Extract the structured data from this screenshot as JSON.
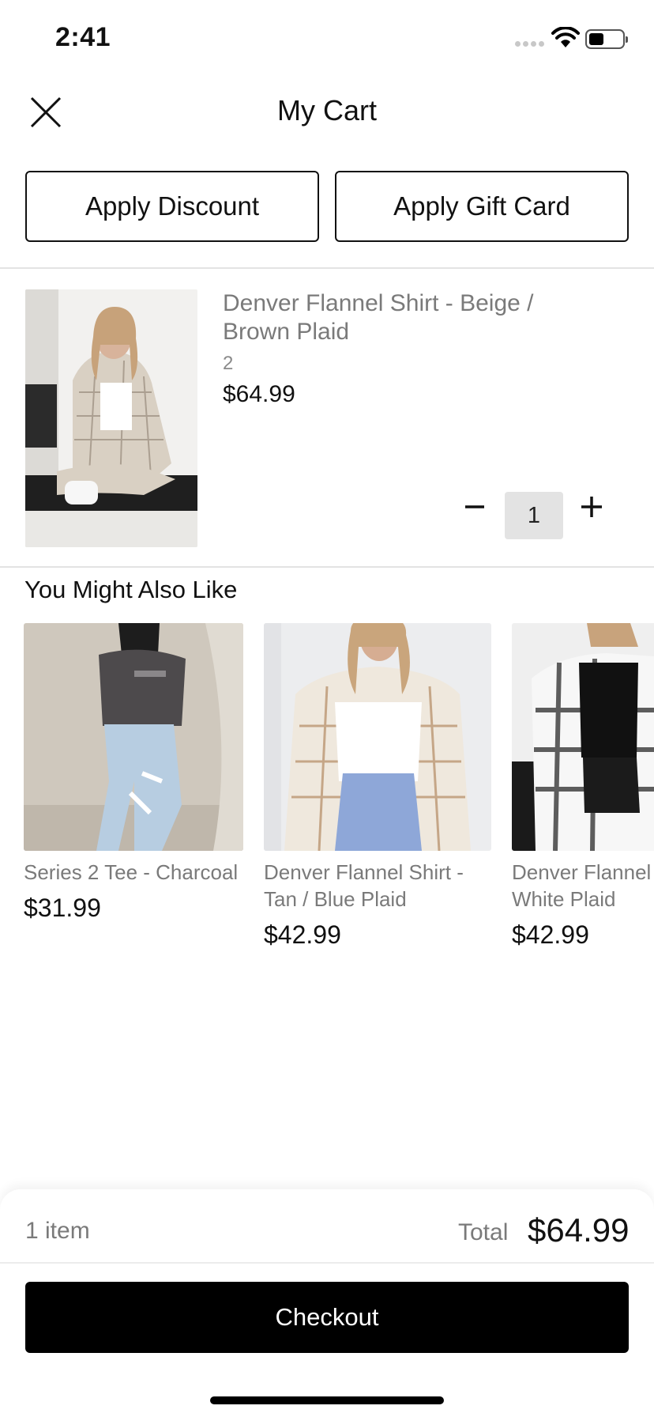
{
  "status_bar": {
    "time": "2:41",
    "battery_level": 0.45
  },
  "header": {
    "title": "My Cart",
    "close_icon": "close-x-icon"
  },
  "actions": {
    "apply_discount": "Apply Discount",
    "apply_gift_card": "Apply Gift Card"
  },
  "cart": {
    "items": [
      {
        "name": "Denver Flannel Shirt - Beige / Brown Plaid",
        "variant": "2",
        "price": "$64.99",
        "quantity": "1",
        "image": "beige-brown-plaid-flannel-photo"
      }
    ]
  },
  "recommendations": {
    "title": "You Might Also Like",
    "items": [
      {
        "name_line1": "Series 2 Tee - Charcoal",
        "name_line2": "",
        "price": "$31.99",
        "image": "charcoal-tee-photo"
      },
      {
        "name_line1": "Denver Flannel Shirt -",
        "name_line2": "Tan / Blue Plaid",
        "price": "$42.99",
        "image": "tan-blue-plaid-flannel-photo"
      },
      {
        "name_line1": "Denver Flannel",
        "name_line2": "White Plaid",
        "price": "$42.99",
        "image": "black-white-plaid-flannel-photo"
      }
    ]
  },
  "footer": {
    "item_count": "1 item",
    "total_label": "Total",
    "total_value": "$64.99",
    "checkout_label": "Checkout"
  },
  "colors": {
    "primary": "#000000",
    "muted_text": "#7a7a7a",
    "qty_bg": "#e3e3e3",
    "divider": "#e3e3e3"
  }
}
